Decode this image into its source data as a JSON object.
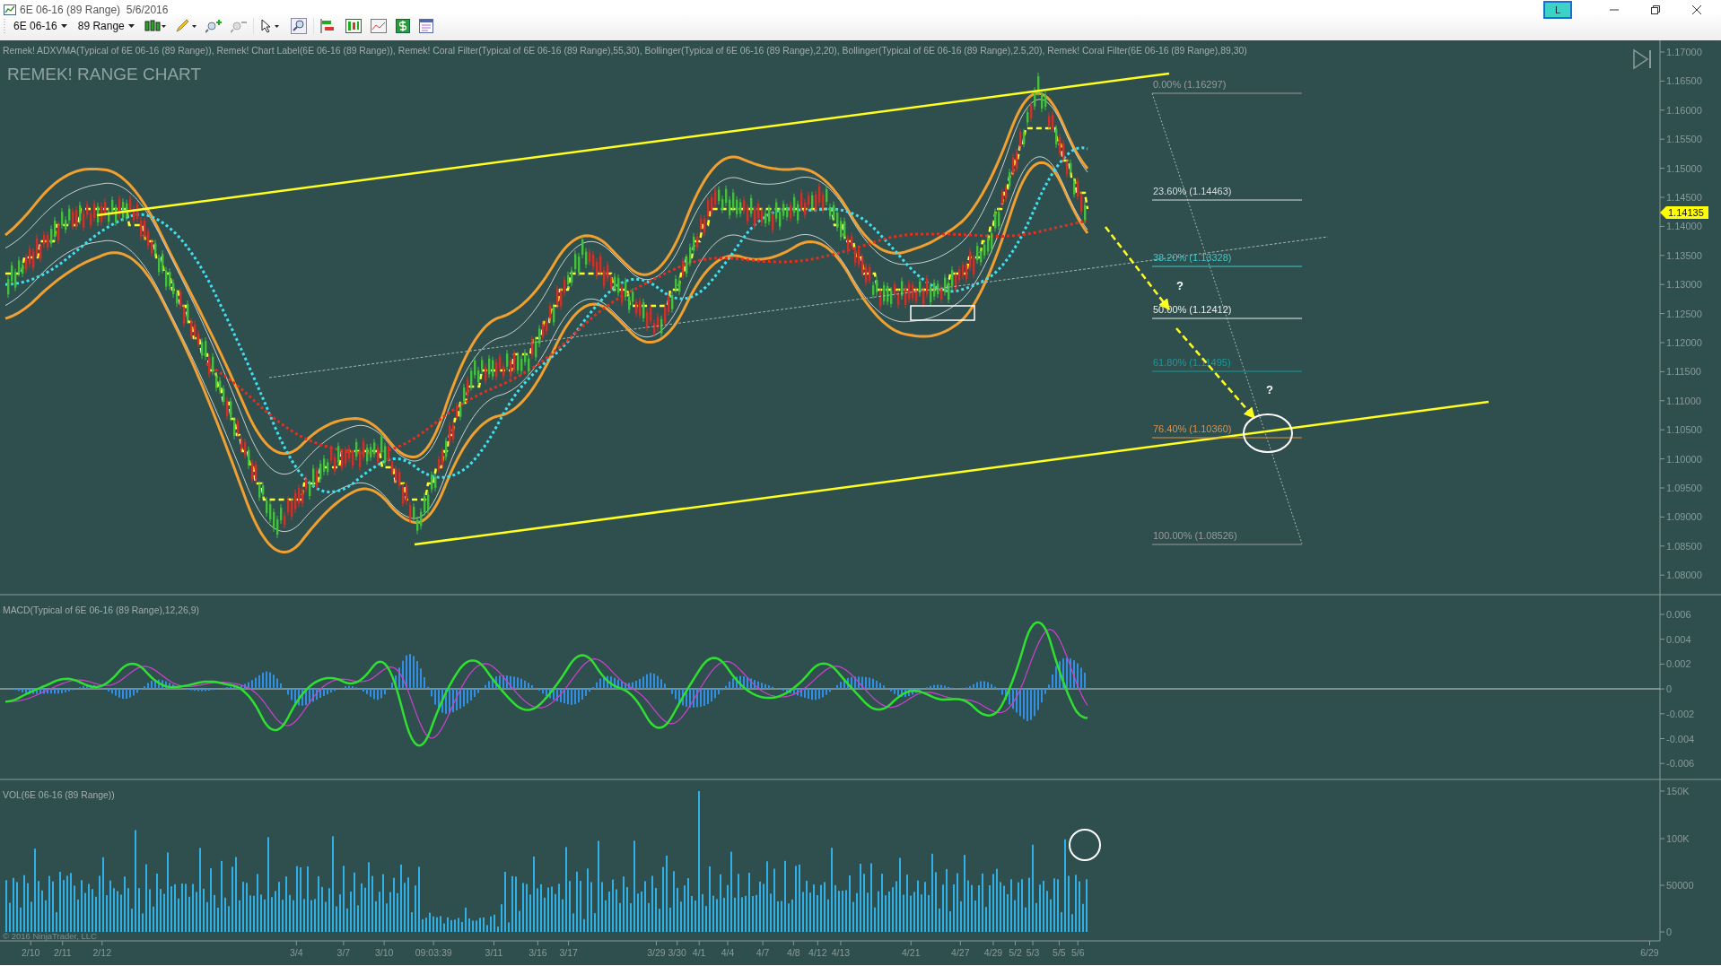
{
  "window": {
    "title": "6E 06-16 (89 Range)  5/6/2016",
    "badge": "L"
  },
  "toolbar": {
    "instrument": "6E 06-16",
    "period": "89 Range"
  },
  "indicator_legend": "Remek! ADXVMA(Typical of 6E 06-16 (89 Range)), Remek! Chart Label(6E 06-16 (89 Range)), Remek! Coral Filter(Typical of 6E 06-16 (89 Range),55,30), Bollinger(Typical of 6E 06-16 (89 Range),2,20), Bollinger(Typical of 6E 06-16 (89 Range),2.5,20), Remek! Coral Filter(6E 06-16 (89 Range),89,30)",
  "chart_title": "REMEK! RANGE CHART",
  "price_axis": {
    "ticks": [
      "1.17000",
      "1.16500",
      "1.16000",
      "1.15500",
      "1.15000",
      "1.14500",
      "1.14000",
      "1.13500",
      "1.13000",
      "1.12500",
      "1.12000",
      "1.11500",
      "1.11000",
      "1.10500",
      "1.10000",
      "1.09500",
      "1.09000",
      "1.08500",
      "1.08000"
    ],
    "last_price": "1.14135"
  },
  "fib_levels": [
    {
      "label": "0.00% (1.16297)",
      "color": "#9a9a9a"
    },
    {
      "label": "23.60% (1.14463)",
      "color": "#d8dde2"
    },
    {
      "label": "38.20% (1.13328)",
      "color": "#40c8c8"
    },
    {
      "label": "50.00% (1.12412)",
      "color": "#eeeeee"
    },
    {
      "label": "61.80% (1.11495)",
      "color": "#1a9a9a"
    },
    {
      "label": "76.40% (1.10360)",
      "color": "#e09040"
    },
    {
      "label": "100.00% (1.08526)",
      "color": "#9a9a9a"
    }
  ],
  "question_marks": [
    "?",
    "?"
  ],
  "macd": {
    "label": "MACD(Typical of 6E 06-16 (89 Range),12,26,9)",
    "ticks": [
      "0.006",
      "0.004",
      "0.002",
      "0",
      "-0.002",
      "-0.004",
      "-0.006"
    ]
  },
  "volume": {
    "label": "VOL(6E 06-16 (89 Range))",
    "ticks": [
      "150K",
      "100K",
      "50000",
      "0"
    ]
  },
  "time_axis": [
    "2/10",
    "2/11",
    "2/12",
    "3/4",
    "3/7",
    "3/10",
    "09:03:39",
    "3/11",
    "3/16",
    "3/17",
    "3/29",
    "3/30",
    "4/1",
    "4/4",
    "4/7",
    "4/8",
    "4/12",
    "4/13",
    "4/21",
    "4/27",
    "4/29",
    "5/2",
    "5/3",
    "5/5",
    "5/6",
    "6/29"
  ],
  "copyright": "© 2016 NinjaTrader, LLC"
}
